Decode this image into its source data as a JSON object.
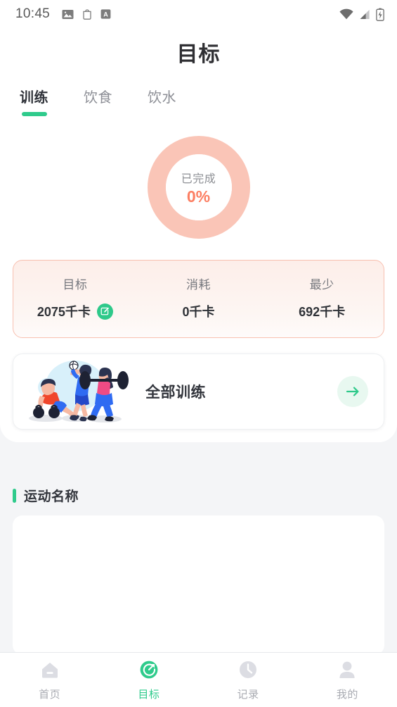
{
  "status_bar": {
    "time": "10:45",
    "left_icons": [
      "image-icon",
      "clipboard-icon",
      "app-badge-icon"
    ],
    "right_icons": [
      "wifi-icon",
      "cellular-signal-icon",
      "battery-charging-icon"
    ]
  },
  "header": {
    "title": "目标"
  },
  "tabs": [
    {
      "label": "训练",
      "active": true
    },
    {
      "label": "饮食",
      "active": false
    },
    {
      "label": "饮水",
      "active": false
    }
  ],
  "progress_ring": {
    "label": "已完成",
    "value": "0%",
    "percent": 0,
    "track_color": "#fac5b7",
    "value_color": "#fc7f63"
  },
  "stats": {
    "items": [
      {
        "label": "目标",
        "value": "2075千卡",
        "has_edit": true
      },
      {
        "label": "消耗",
        "value": "0千卡",
        "has_edit": false
      },
      {
        "label": "最少",
        "value": "692千卡",
        "has_edit": false
      }
    ],
    "border_color": "#f8c0b0",
    "edit_badge_color": "#2ec98a"
  },
  "training_card": {
    "title": "全部训练",
    "arrow_icon": "arrow-right-icon",
    "arrow_color": "#2ec98a",
    "arrow_bg": "#e8f8f0"
  },
  "exercise_section": {
    "title": "运动名称",
    "accent_color": "#2fcb8c"
  },
  "bottom_nav": [
    {
      "label": "首页",
      "icon": "home-icon",
      "active": false
    },
    {
      "label": "目标",
      "icon": "target-icon",
      "active": true
    },
    {
      "label": "记录",
      "icon": "clock-icon",
      "active": false
    },
    {
      "label": "我的",
      "icon": "person-icon",
      "active": false
    }
  ],
  "theme": {
    "accent_green": "#2fcb8c",
    "accent_salmon": "#fc7f63",
    "page_bg": "#f4f5f7"
  }
}
